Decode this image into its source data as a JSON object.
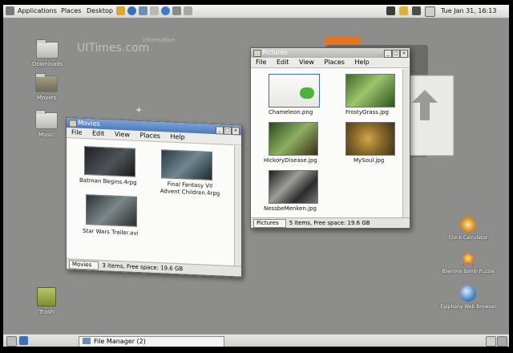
{
  "top_panel": {
    "menus": [
      "Applications",
      "Places",
      "Desktop"
    ],
    "clock": "Tue Jan 31, 16:13"
  },
  "desktop": {
    "icons": [
      "Downloads",
      "Movies",
      "Music",
      "Trash"
    ],
    "watermark": "UITimes.com",
    "watermark_small": "information",
    "right_icons": [
      "Clock Calculator",
      "Blammo Bomb Puzzle",
      "Epiphany Web Browser"
    ]
  },
  "movies_window": {
    "title": "Movies",
    "menu": [
      "File",
      "Edit",
      "View",
      "Places",
      "Help"
    ],
    "items": [
      "Batman Begins.4rpg",
      "Final Fantasy VII Advent Children.4rpg",
      "Star Wars Trailer.avi"
    ],
    "status_location": "Movies",
    "status_text": "3 items, Free space: 19.6 GB"
  },
  "pictures_window": {
    "title": "Pictures",
    "menu": [
      "File",
      "Edit",
      "View",
      "Places",
      "Help"
    ],
    "items": [
      "Chameleon.png",
      "FrostyGrass.jpg",
      "HickoryDisease.jpg",
      "MySoul.jpg",
      "NessbeMenken.jpg"
    ],
    "status_location": "Pictures",
    "status_text": "5 items, Free space: 19.6 GB"
  },
  "bottom_panel": {
    "task": "File Manager (2)"
  }
}
